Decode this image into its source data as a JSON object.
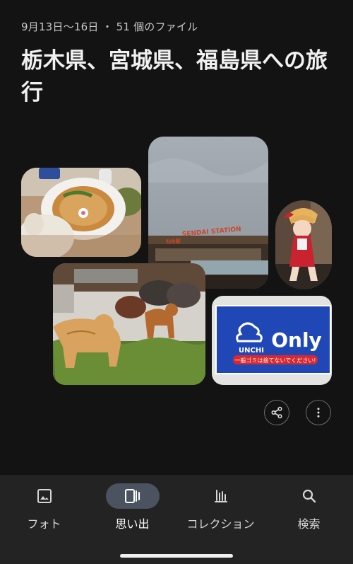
{
  "header": {
    "meta": "9月13日〜16日 ・ 51 個のファイル",
    "title": "栃木県、宮城県、福島県への旅行"
  },
  "photos": {
    "station_sign": "SENDAI STATION",
    "station_sign_jp": "仙台駅",
    "sign_brand": "Only",
    "sign_brand_small": "UNCHI",
    "sign_notice": "一般ゴミは捨てないでください!"
  },
  "nav": {
    "items": [
      {
        "label": "フォト",
        "icon": "photo-icon"
      },
      {
        "label": "思い出",
        "icon": "memories-icon",
        "active": true
      },
      {
        "label": "コレクション",
        "icon": "collection-icon"
      },
      {
        "label": "検索",
        "icon": "search-icon"
      }
    ]
  },
  "colors": {
    "background": "#131313",
    "navbar": "#232323",
    "active_pill": "#4b5260",
    "sign_blue": "#1f47b5",
    "sign_red": "#d8282f"
  }
}
